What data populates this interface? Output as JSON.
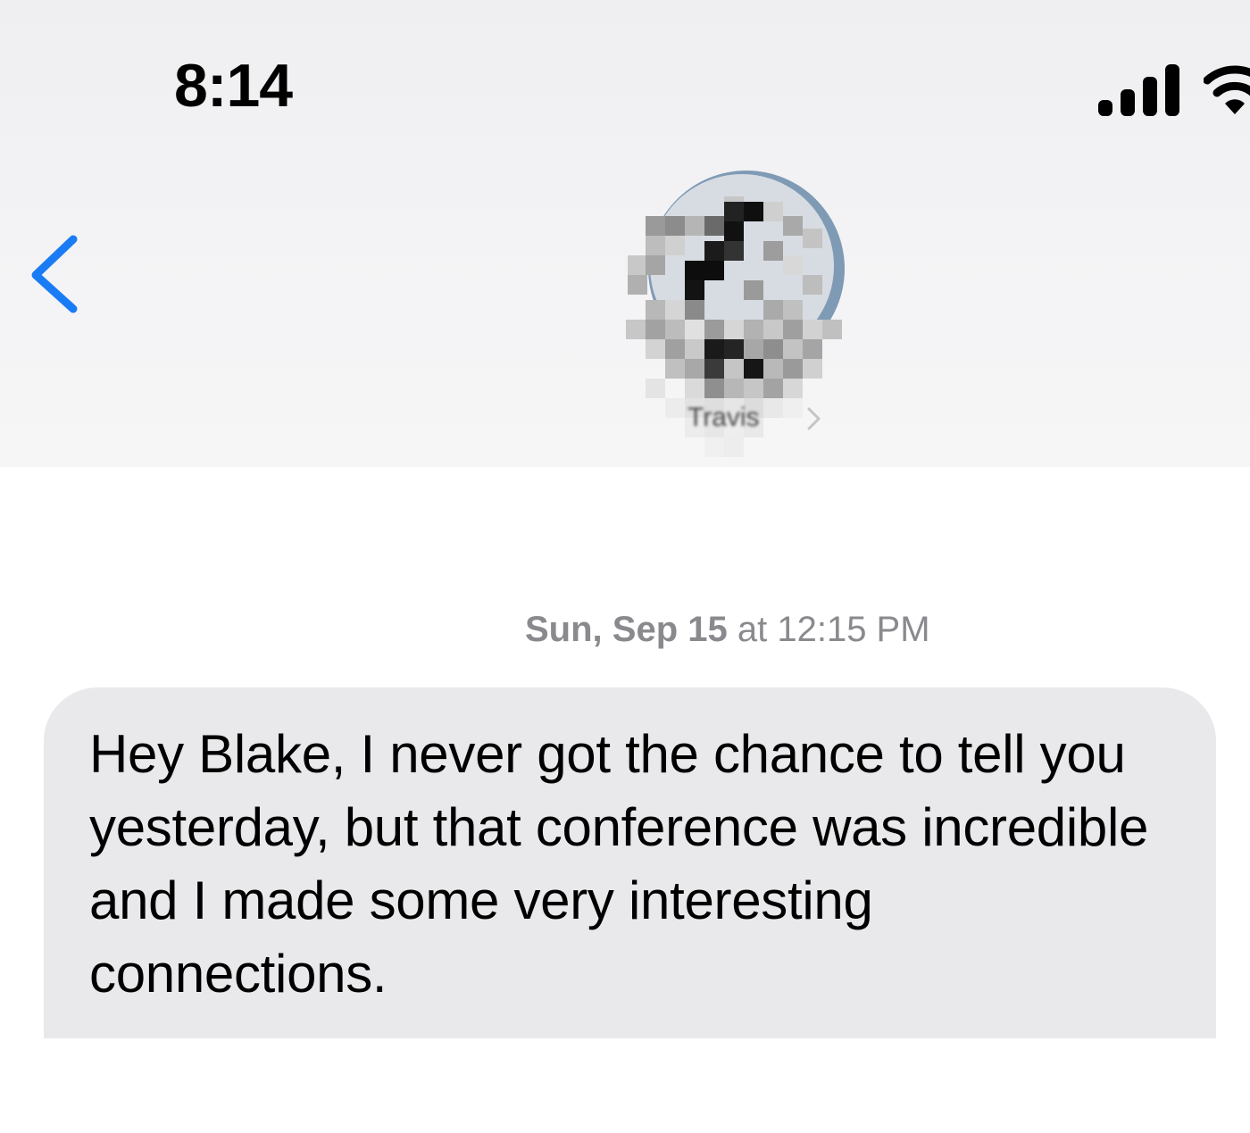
{
  "status_bar": {
    "time": "8:14",
    "signal_icon": "cellular-signal-icon",
    "wifi_icon": "wifi-icon"
  },
  "nav": {
    "back_icon": "chevron-left-icon",
    "contact_name": "Travis",
    "contact_chevron_icon": "chevron-right-icon",
    "avatar": "pixelated-contact-avatar"
  },
  "conversation": {
    "timestamp_day": "Sun, Sep 15",
    "timestamp_time": " at 12:15 PM",
    "messages": [
      {
        "direction": "incoming",
        "text": "Hey Blake, I never got the chance to tell you yesterday, but that conference was incredible and I made some very interesting connections."
      }
    ]
  },
  "colors": {
    "accent": "#1a7cf5",
    "incoming_bubble": "#e9e9eb",
    "timestamp_gray": "#8a8a8e"
  }
}
